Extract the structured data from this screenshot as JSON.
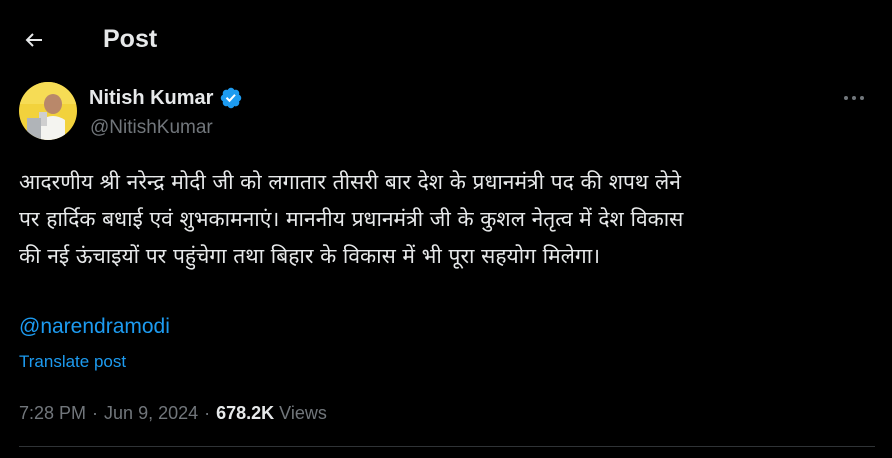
{
  "header": {
    "title": "Post",
    "back_icon": "arrow-left-icon"
  },
  "author": {
    "name": "Nitish Kumar",
    "handle": "@NitishKumar",
    "verified_icon": "verified-badge-icon",
    "verified_color": "#1d9bf0"
  },
  "post": {
    "text": "आदरणीय श्री नरेन्द्र मोदी जी को लगातार तीसरी बार देश के प्रधानमंत्री पद की शपथ लेने\nपर हार्दिक बधाई एवं शुभकामनाएं। माननीय प्रधानमंत्री जी के कुशल नेतृत्व में देश विकास\nकी नई ऊंचाइयों पर पहुंचेगा तथा बिहार के विकास में भी पूरा सहयोग मिलेगा।",
    "mention": "@narendramodi",
    "translate_label": "Translate post",
    "time": "7:28 PM",
    "date": "Jun 9, 2024",
    "separator": "·",
    "views_count": "678.2K",
    "views_label": "Views"
  },
  "colors": {
    "background": "#000000",
    "text": "#e7e9ea",
    "muted": "#71767b",
    "link": "#1d9bf0",
    "divider": "#2f3336"
  }
}
